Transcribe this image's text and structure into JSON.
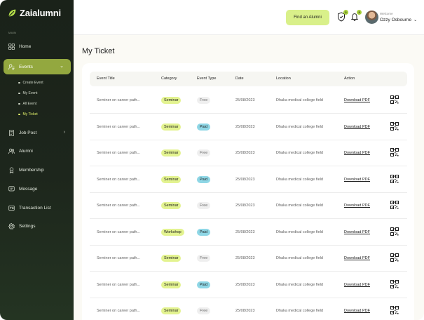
{
  "sidebar": {
    "brand": "Zaialumni",
    "section_label": "MAIN",
    "items": [
      {
        "label": "Home"
      },
      {
        "label": "Events"
      },
      {
        "label": "Job Post"
      },
      {
        "label": "Alumni"
      },
      {
        "label": "Membership"
      },
      {
        "label": "Message"
      },
      {
        "label": "Transaction List"
      },
      {
        "label": "Settings"
      }
    ],
    "events_sub": [
      {
        "label": "Create Event"
      },
      {
        "label": "My Event"
      },
      {
        "label": "All Event"
      },
      {
        "label": "My Ticket"
      }
    ]
  },
  "header": {
    "find_button": "Find an Alumni",
    "shield_badge": "2",
    "bell_badge": "3",
    "welcome": "Welcome",
    "username": "Ozzy Osbourne"
  },
  "main": {
    "title": "My Ticket",
    "columns": [
      "Event Title",
      "Category",
      "Event Type",
      "Date",
      "Location",
      "Action"
    ],
    "rows": [
      {
        "title": "Seminer on career path...",
        "category": "Seminar",
        "type": "Free",
        "date": "25/08/2023",
        "location": "Dhaka medical college field",
        "action": "Download PDF"
      },
      {
        "title": "Seminer on career path...",
        "category": "Seminar",
        "type": "Paid",
        "date": "25/08/2023",
        "location": "Dhaka medical college field",
        "action": "Download PDF"
      },
      {
        "title": "Seminer on career path...",
        "category": "Seminar",
        "type": "Free",
        "date": "25/08/2023",
        "location": "Dhaka medical college field",
        "action": "Download PDF"
      },
      {
        "title": "Seminer on career path...",
        "category": "Seminar",
        "type": "Paid",
        "date": "25/08/2023",
        "location": "Dhaka medical college field",
        "action": "Download PDF"
      },
      {
        "title": "Seminer on career path...",
        "category": "Seminar",
        "type": "Free",
        "date": "25/08/2023",
        "location": "Dhaka medical college field",
        "action": "Download PDF"
      },
      {
        "title": "Seminer on career path...",
        "category": "Workshop",
        "type": "Paid",
        "date": "25/08/2023",
        "location": "Dhaka medical college field",
        "action": "Download PDF"
      },
      {
        "title": "Seminer on career path...",
        "category": "Seminar",
        "type": "Free",
        "date": "25/08/2023",
        "location": "Dhaka medical college field",
        "action": "Download PDF"
      },
      {
        "title": "Seminer on career path...",
        "category": "Seminar",
        "type": "Paid",
        "date": "25/08/2023",
        "location": "Dhaka medical college field",
        "action": "Download PDF"
      },
      {
        "title": "Seminer on career path...",
        "category": "Seminar",
        "type": "Free",
        "date": "25/08/2023",
        "location": "Dhaka medical college field",
        "action": "Download PDF"
      }
    ]
  },
  "colors": {
    "sidebar_bg": "#1d261c",
    "active_nav": "#93a83f",
    "accent_lime": "#d9f08a",
    "paid_badge": "#8fd7e6",
    "free_badge": "#efefef"
  },
  "icons": {
    "brand": "leaf-icon",
    "home": "grid-icon",
    "events": "calendar-user-icon",
    "job_post": "document-icon",
    "alumni": "users-icon",
    "membership": "badge-icon",
    "message": "message-icon",
    "transaction": "receipt-icon",
    "settings": "gear-icon",
    "row_action": "qr-code-icon"
  }
}
